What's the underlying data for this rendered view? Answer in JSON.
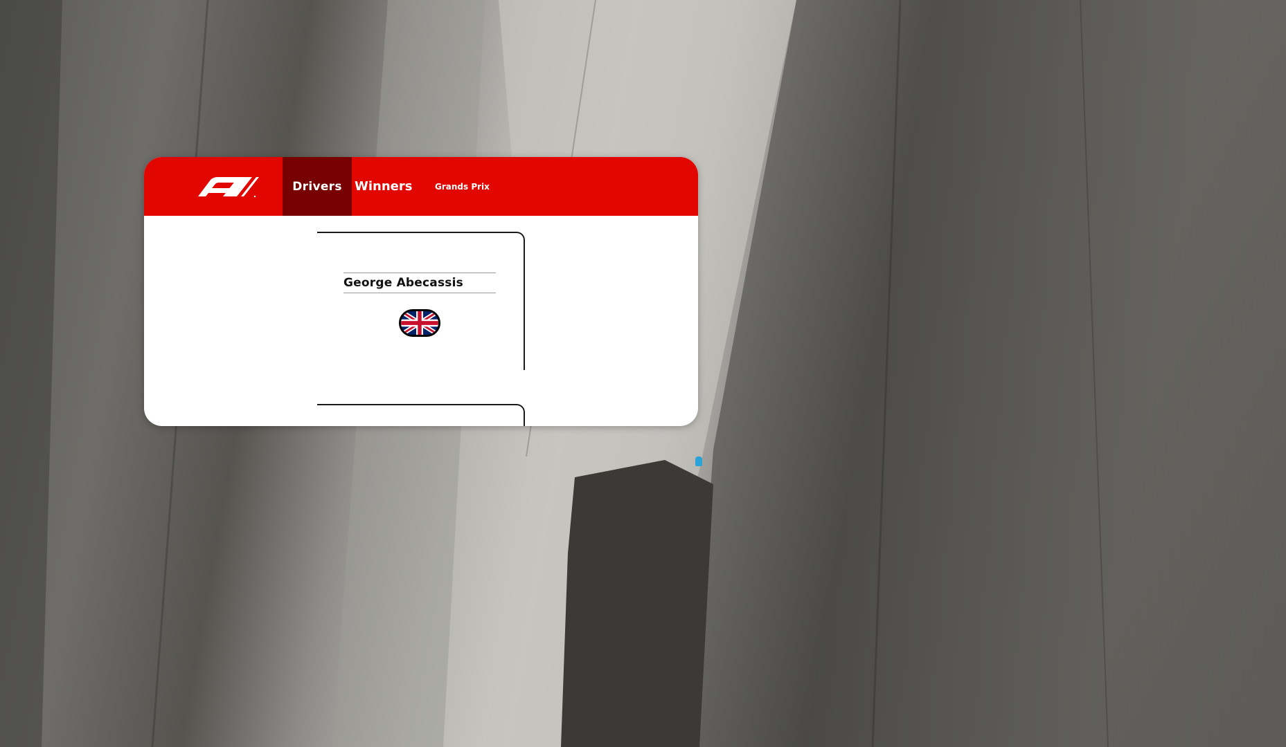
{
  "app": {
    "header": {
      "logo": "f1-logo",
      "nav": [
        {
          "label": "Drivers",
          "active": true
        },
        {
          "label": "Winners",
          "active": false
        },
        {
          "label": "Grands Prix",
          "active": false
        }
      ]
    },
    "driver": {
      "name": "George Abecassis",
      "nationality_flag": "uk-flag-icon"
    },
    "colors": {
      "brand_red": "#e10600",
      "active_tab": "#770000"
    }
  }
}
